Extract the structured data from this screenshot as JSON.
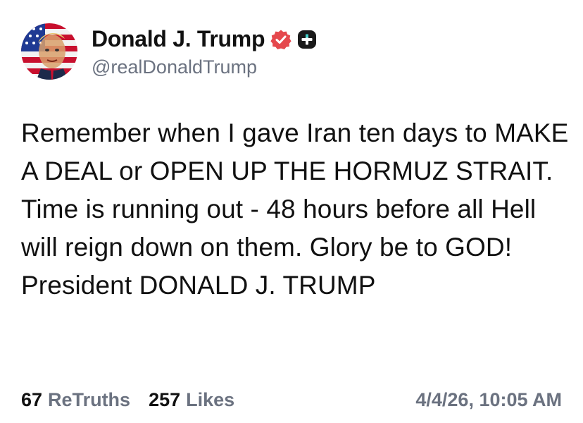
{
  "author": {
    "display_name": "Donald J. Trump",
    "handle": "@realDonaldTrump",
    "avatar_icon": "portrait-flag-avatar",
    "verified_icon": "verified-badge-icon",
    "verified_color": "#e5484d",
    "plus_icon": "plus-badge-icon"
  },
  "post": {
    "text": "Remember when I gave Iran ten days to MAKE A DEAL or OPEN UP THE HORMUZ STRAIT. Time is running out - 48 hours before all Hell will reign down on them. Glory be to GOD! President DONALD J. TRUMP"
  },
  "stats": {
    "retruths_count": "67",
    "retruths_label": "ReTruths",
    "likes_count": "257",
    "likes_label": "Likes"
  },
  "timestamp": "4/4/26, 10:05 AM",
  "colors": {
    "text": "#111111",
    "muted": "#6b7280",
    "background": "#ffffff"
  }
}
